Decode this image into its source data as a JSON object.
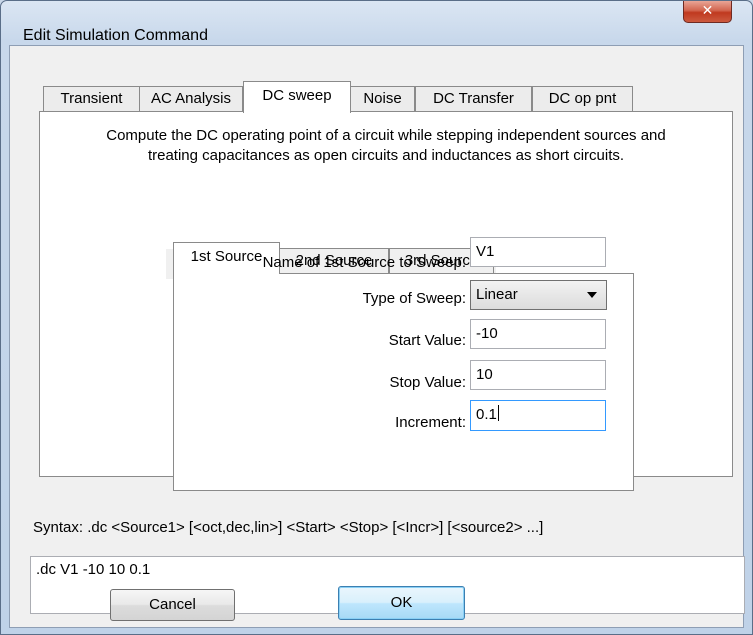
{
  "window": {
    "title": "Edit Simulation Command",
    "close_glyph": "✕"
  },
  "tabs": [
    {
      "label": "Transient"
    },
    {
      "label": "AC Analysis"
    },
    {
      "label": "DC sweep"
    },
    {
      "label": "Noise"
    },
    {
      "label": "DC Transfer"
    },
    {
      "label": "DC op pnt"
    }
  ],
  "active_tab": "DC sweep",
  "description": {
    "line1": "Compute the DC operating point of a circuit while stepping independent sources and",
    "line2": "treating capacitances as open circuits and inductances as short circuits."
  },
  "source_tabs": [
    {
      "label": "1st Source"
    },
    {
      "label": "2nd Source"
    },
    {
      "label": "3rd Source"
    }
  ],
  "active_source_tab": "1st Source",
  "form": {
    "source_name": {
      "label": "Name of 1st Source to Sweep:",
      "value": "V1"
    },
    "sweep_type": {
      "label": "Type of Sweep:",
      "value": "Linear"
    },
    "start": {
      "label": "Start Value:",
      "value": "-10"
    },
    "stop": {
      "label": "Stop Value:",
      "value": "10"
    },
    "increment": {
      "label": "Increment:",
      "value": "0.1"
    }
  },
  "syntax": "Syntax:  .dc <Source1> [<oct,dec,lin>] <Start> <Stop> [<Incr>] [<source2> ...]",
  "command": ".dc V1 -10 10 0.1",
  "buttons": {
    "cancel": "Cancel",
    "ok": "OK"
  }
}
